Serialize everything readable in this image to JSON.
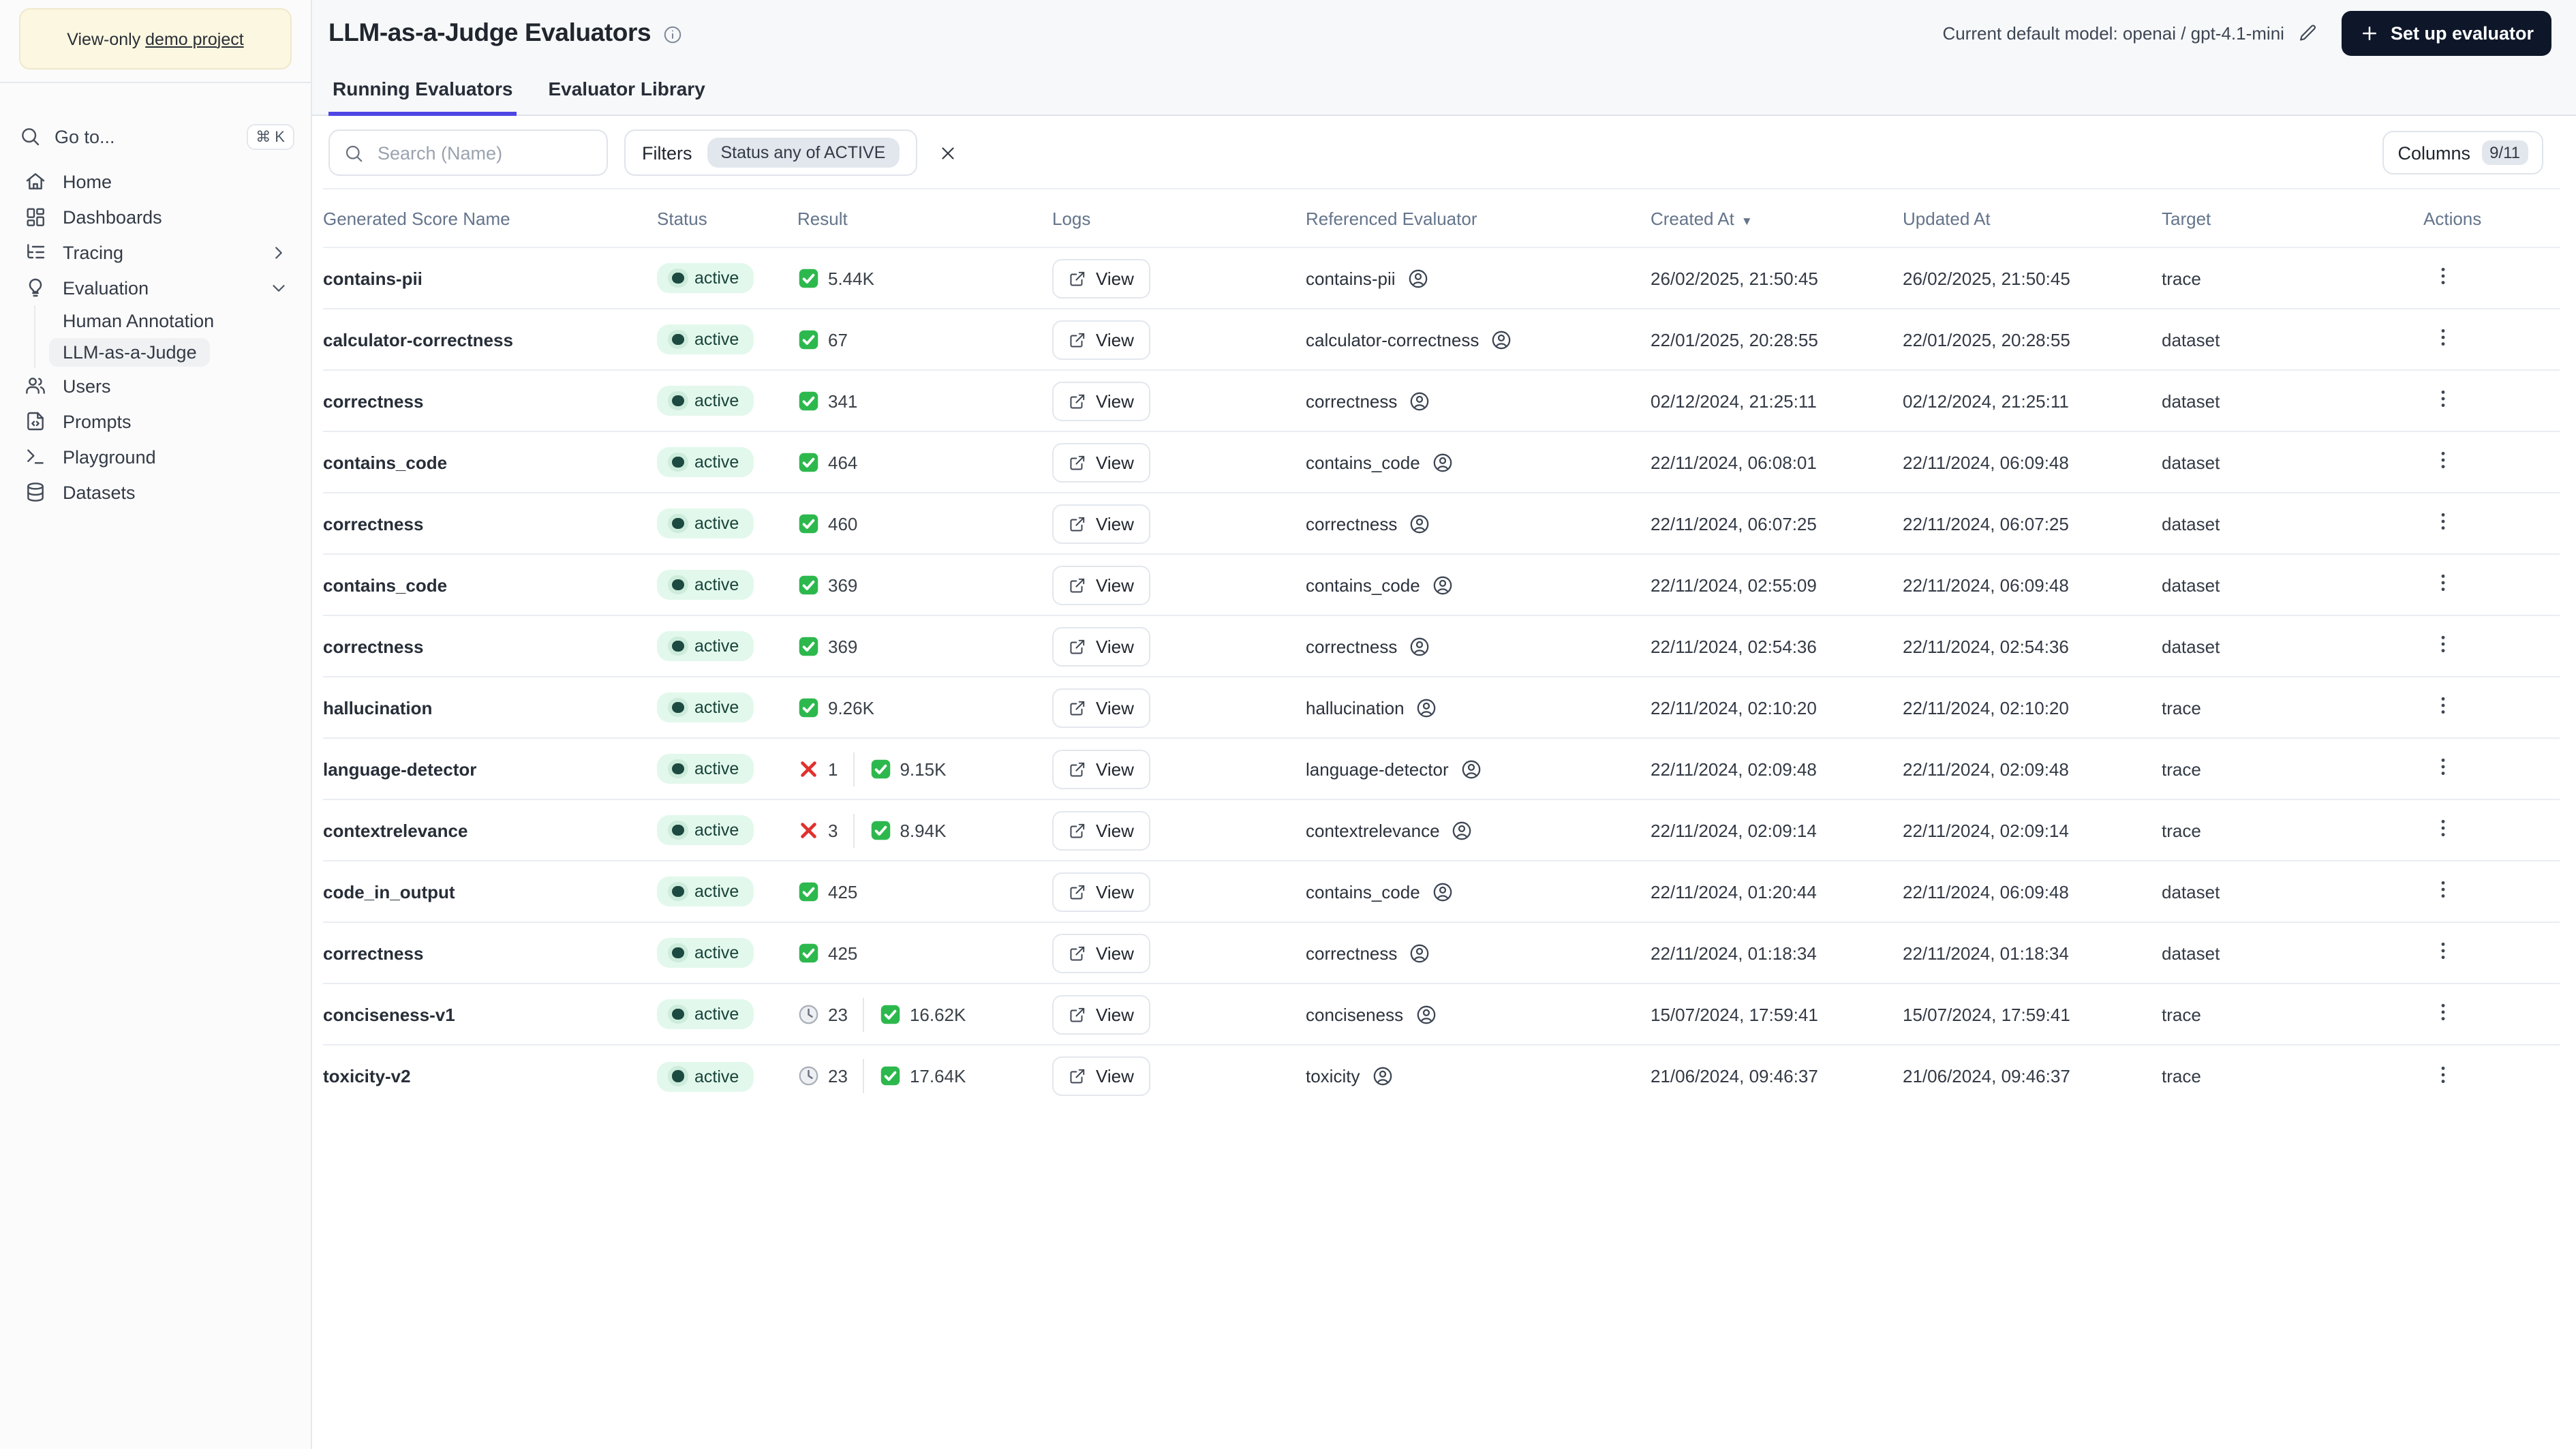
{
  "colors": {
    "accent": "#4f46e5",
    "topbar_bg": "#f7f8fa",
    "sidebar_bg": "#fbfbfc",
    "border": "#e5e8ee",
    "row_border": "#e9edf2",
    "banner_bg": "#fcf7e1",
    "banner_border": "#f0e8cb",
    "badge_green_bg": "#e3f8ec",
    "badge_green_text": "#17433a",
    "badge_green_dot": "#1d4a40",
    "check_green": "#2db84d",
    "error_red": "#e0312d",
    "button_dark": "#0e1729",
    "chip_bg": "#e2e7ee"
  },
  "sidebar": {
    "banner": {
      "prefix": "View-only ",
      "link_label": "demo project"
    },
    "goto": {
      "label": "Go to...",
      "shortcut": "⌘ K",
      "icon": "search-icon"
    },
    "nav": [
      {
        "label": "Home",
        "icon": "home-icon"
      },
      {
        "label": "Dashboards",
        "icon": "dashboards-icon"
      },
      {
        "label": "Tracing",
        "icon": "tracing-icon",
        "chevron": "chevron-right-icon"
      },
      {
        "label": "Evaluation",
        "icon": "lightbulb-icon",
        "chevron": "chevron-down-icon"
      },
      {
        "label": "Human Annotation",
        "sub": true
      },
      {
        "label": "LLM-as-a-Judge",
        "sub": true,
        "active": true
      },
      {
        "label": "Users",
        "icon": "users-icon"
      },
      {
        "label": "Prompts",
        "icon": "prompts-icon"
      },
      {
        "label": "Playground",
        "icon": "terminal-icon"
      },
      {
        "label": "Datasets",
        "icon": "database-icon"
      }
    ]
  },
  "header": {
    "title": "LLM-as-a-Judge Evaluators",
    "title_info_icon": "info-icon",
    "model_label": "Current default model: openai / gpt-4.1-mini",
    "edit_icon": "pencil-icon",
    "setup_button_label": "Set up evaluator"
  },
  "tabs": [
    {
      "label": "Running Evaluators",
      "active": true
    },
    {
      "label": "Evaluator Library",
      "active": false
    }
  ],
  "toolbar": {
    "search_placeholder": "Search (Name)",
    "filters_label": "Filters",
    "filter_chip": "Status any of ACTIVE",
    "columns_label": "Columns",
    "columns_count": "9/11"
  },
  "table": {
    "headers": [
      "Generated Score Name",
      "Status",
      "Result",
      "Logs",
      "Referenced Evaluator",
      "Created At",
      "Updated At",
      "Target",
      "Actions"
    ],
    "sorted_by": "Created At",
    "sort_direction": "desc",
    "view_label": "View",
    "rows": [
      {
        "name": "contains-pii",
        "status": "active",
        "result": [
          {
            "icon": "check-icon",
            "value": "5.44K"
          }
        ],
        "referenced": "contains-pii",
        "created": "26/02/2025, 21:50:45",
        "updated": "26/02/2025, 21:50:45",
        "target": "trace"
      },
      {
        "name": "calculator-correctness",
        "status": "active",
        "result": [
          {
            "icon": "check-icon",
            "value": "67"
          }
        ],
        "referenced": "calculator-correctness",
        "created": "22/01/2025, 20:28:55",
        "updated": "22/01/2025, 20:28:55",
        "target": "dataset"
      },
      {
        "name": "correctness",
        "status": "active",
        "result": [
          {
            "icon": "check-icon",
            "value": "341"
          }
        ],
        "referenced": "correctness",
        "created": "02/12/2024, 21:25:11",
        "updated": "02/12/2024, 21:25:11",
        "target": "dataset"
      },
      {
        "name": "contains_code",
        "status": "active",
        "result": [
          {
            "icon": "check-icon",
            "value": "464"
          }
        ],
        "referenced": "contains_code",
        "created": "22/11/2024, 06:08:01",
        "updated": "22/11/2024, 06:09:48",
        "target": "dataset"
      },
      {
        "name": "correctness",
        "status": "active",
        "result": [
          {
            "icon": "check-icon",
            "value": "460"
          }
        ],
        "referenced": "correctness",
        "created": "22/11/2024, 06:07:25",
        "updated": "22/11/2024, 06:07:25",
        "target": "dataset"
      },
      {
        "name": "contains_code",
        "status": "active",
        "result": [
          {
            "icon": "check-icon",
            "value": "369"
          }
        ],
        "referenced": "contains_code",
        "created": "22/11/2024, 02:55:09",
        "updated": "22/11/2024, 06:09:48",
        "target": "dataset"
      },
      {
        "name": "correctness",
        "status": "active",
        "result": [
          {
            "icon": "check-icon",
            "value": "369"
          }
        ],
        "referenced": "correctness",
        "created": "22/11/2024, 02:54:36",
        "updated": "22/11/2024, 02:54:36",
        "target": "dataset"
      },
      {
        "name": "hallucination",
        "status": "active",
        "result": [
          {
            "icon": "check-icon",
            "value": "9.26K"
          }
        ],
        "referenced": "hallucination",
        "created": "22/11/2024, 02:10:20",
        "updated": "22/11/2024, 02:10:20",
        "target": "trace"
      },
      {
        "name": "language-detector",
        "status": "active",
        "result": [
          {
            "icon": "x-mark-icon",
            "value": "1"
          },
          {
            "icon": "check-icon",
            "value": "9.15K"
          }
        ],
        "referenced": "language-detector",
        "created": "22/11/2024, 02:09:48",
        "updated": "22/11/2024, 02:09:48",
        "target": "trace"
      },
      {
        "name": "contextrelevance",
        "status": "active",
        "result": [
          {
            "icon": "x-mark-icon",
            "value": "3"
          },
          {
            "icon": "check-icon",
            "value": "8.94K"
          }
        ],
        "referenced": "contextrelevance",
        "created": "22/11/2024, 02:09:14",
        "updated": "22/11/2024, 02:09:14",
        "target": "trace"
      },
      {
        "name": "code_in_output",
        "status": "active",
        "result": [
          {
            "icon": "check-icon",
            "value": "425"
          }
        ],
        "referenced": "contains_code",
        "created": "22/11/2024, 01:20:44",
        "updated": "22/11/2024, 06:09:48",
        "target": "dataset"
      },
      {
        "name": "correctness",
        "status": "active",
        "result": [
          {
            "icon": "check-icon",
            "value": "425"
          }
        ],
        "referenced": "correctness",
        "created": "22/11/2024, 01:18:34",
        "updated": "22/11/2024, 01:18:34",
        "target": "dataset"
      },
      {
        "name": "conciseness-v1",
        "status": "active",
        "result": [
          {
            "icon": "clock-icon",
            "value": "23"
          },
          {
            "icon": "check-icon",
            "value": "16.62K"
          }
        ],
        "referenced": "conciseness",
        "created": "15/07/2024, 17:59:41",
        "updated": "15/07/2024, 17:59:41",
        "target": "trace"
      },
      {
        "name": "toxicity-v2",
        "status": "active",
        "result": [
          {
            "icon": "clock-icon",
            "value": "23"
          },
          {
            "icon": "check-icon",
            "value": "17.64K"
          }
        ],
        "referenced": "toxicity",
        "created": "21/06/2024, 09:46:37",
        "updated": "21/06/2024, 09:46:37",
        "target": "trace"
      }
    ]
  }
}
